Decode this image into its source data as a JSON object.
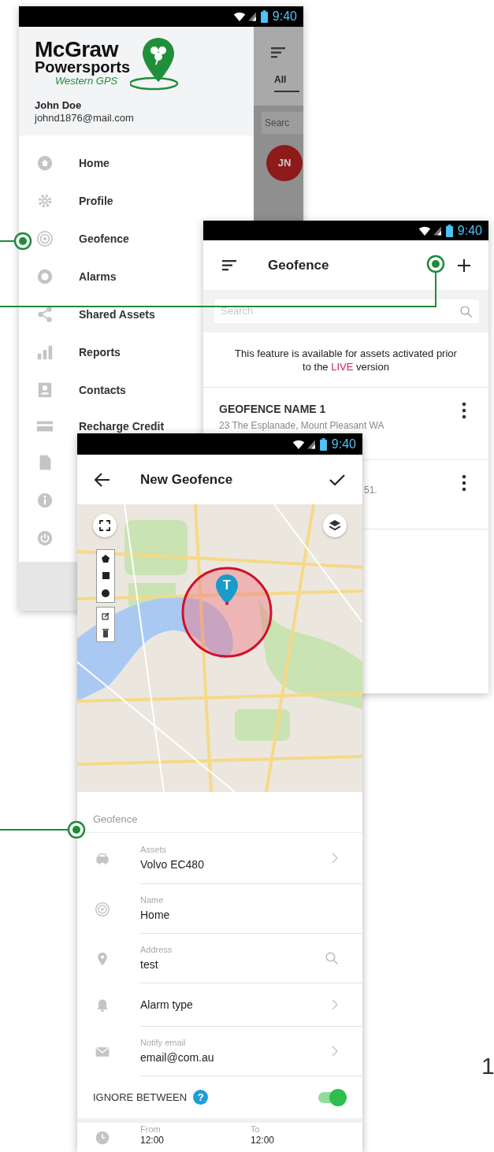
{
  "drawer_screen": {
    "status_time": "9:40",
    "brand": {
      "name": "McGraw",
      "subtitle": "Powersports",
      "tagline": "Western GPS"
    },
    "user": {
      "name": "John Doe",
      "email": "johnd1876@mail.com"
    },
    "menu": [
      {
        "label": "Home"
      },
      {
        "label": "Profile"
      },
      {
        "label": "Geofence"
      },
      {
        "label": "Alarms"
      },
      {
        "label": "Shared Assets"
      },
      {
        "label": "Reports"
      },
      {
        "label": "Contacts"
      },
      {
        "label": "Recharge Credit"
      }
    ],
    "background_list": {
      "tab": "All",
      "search_placeholder": "Searc",
      "avatar_initials": "JN"
    }
  },
  "geofence_list_screen": {
    "status_time": "9:40",
    "title": "Geofence",
    "search_placeholder": "Search",
    "notice": {
      "before": "This feature is available for assets activated prior to the",
      "highlight": "LIVE",
      "after": "version"
    },
    "geofences": [
      {
        "name": "GEOFENCE NAME 1",
        "address": "23 The Esplanade, Mount Pleasant WA"
      },
      {
        "address": "51."
      }
    ]
  },
  "new_geofence_screen": {
    "status_time": "9:40",
    "title": "New Geofence",
    "marker_label": "T",
    "section": "Geofence",
    "fields": [
      {
        "label": "Assets",
        "value": "Volvo EC480",
        "kind": "chevron"
      },
      {
        "label": "Name",
        "value": "Home",
        "kind": "plain"
      },
      {
        "label": "Address",
        "value": "test",
        "kind": "search"
      },
      {
        "value": "Alarm type",
        "kind": "chevron"
      },
      {
        "label": "Notify email",
        "value": "email@com.au",
        "kind": "chevron"
      }
    ],
    "ignore_between": {
      "label": "IGNORE BETWEEN",
      "help": "?",
      "on": true
    },
    "time_range": {
      "from_label": "From",
      "from": "12:00",
      "to_label": "To",
      "to": "12:00"
    }
  },
  "page_number": "1"
}
